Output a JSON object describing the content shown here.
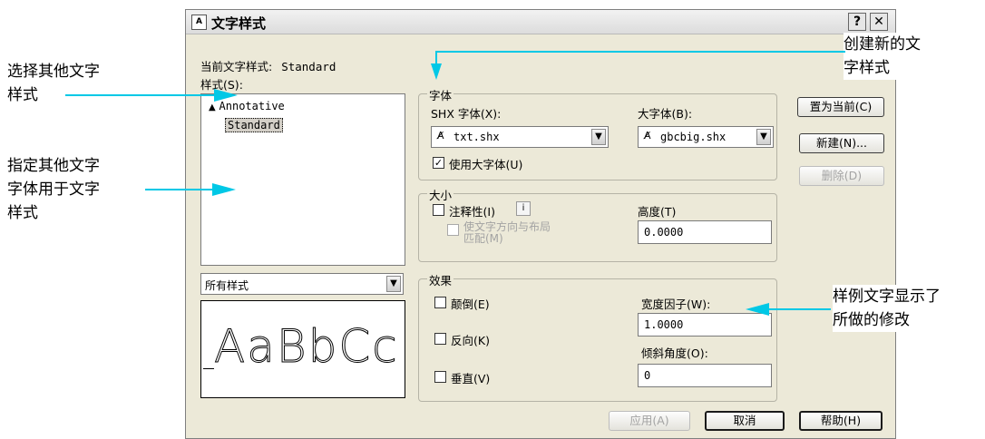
{
  "dialog": {
    "title": "文字样式",
    "title_icon": "text-style-icon",
    "help_btn": "?",
    "close_btn": "✕",
    "current_style_label": "当前文字样式:",
    "current_style_value": "Standard",
    "styles_label": "样式(S):",
    "styles": [
      {
        "icon": "annotative-icon",
        "name": "Annotative"
      },
      {
        "name": "Standard",
        "selected": true
      }
    ],
    "filter_value": "所有样式",
    "preview_text": "AaBbCc",
    "font_group": {
      "title": "字体",
      "shx_label": "SHX 字体(X):",
      "shx_value": "txt.shx",
      "bigfont_label": "大字体(B):",
      "bigfont_value": "gbcbig.shx",
      "use_bigfont_label": "使用大字体(U)",
      "use_bigfont_checked": true
    },
    "size_group": {
      "title": "大小",
      "annotative_label": "注释性(I)",
      "annotative_checked": false,
      "info_icon": "i",
      "match_orientation_line1": "使文字方向与布局",
      "match_orientation_line2": "匹配(M)",
      "height_label": "高度(T)",
      "height_value": "0.0000"
    },
    "effects_group": {
      "title": "效果",
      "upside_down_label": "颠倒(E)",
      "backwards_label": "反向(K)",
      "vertical_label": "垂直(V)",
      "width_factor_label": "宽度因子(W):",
      "width_factor_value": "1.0000",
      "oblique_label": "倾斜角度(O):",
      "oblique_value": "0"
    },
    "buttons": {
      "set_current": "置为当前(C)",
      "new": "新建(N)...",
      "delete": "删除(D)",
      "apply": "应用(A)",
      "cancel": "取消",
      "help": "帮助(H)"
    }
  },
  "annotations": {
    "select_style_1": "选择其他文字",
    "select_style_2": "样式",
    "specify_font_1": "指定其他文字",
    "specify_font_2": "字体用于文字",
    "specify_font_3": "样式",
    "create_new_1": "创建新的文",
    "create_new_2": "字样式",
    "preview_note_1": "样例文字显示了",
    "preview_note_2": "所做的修改"
  },
  "colors": {
    "annotation_arrow": "#00c8e6",
    "dialog_bg": "#ece9d8"
  }
}
